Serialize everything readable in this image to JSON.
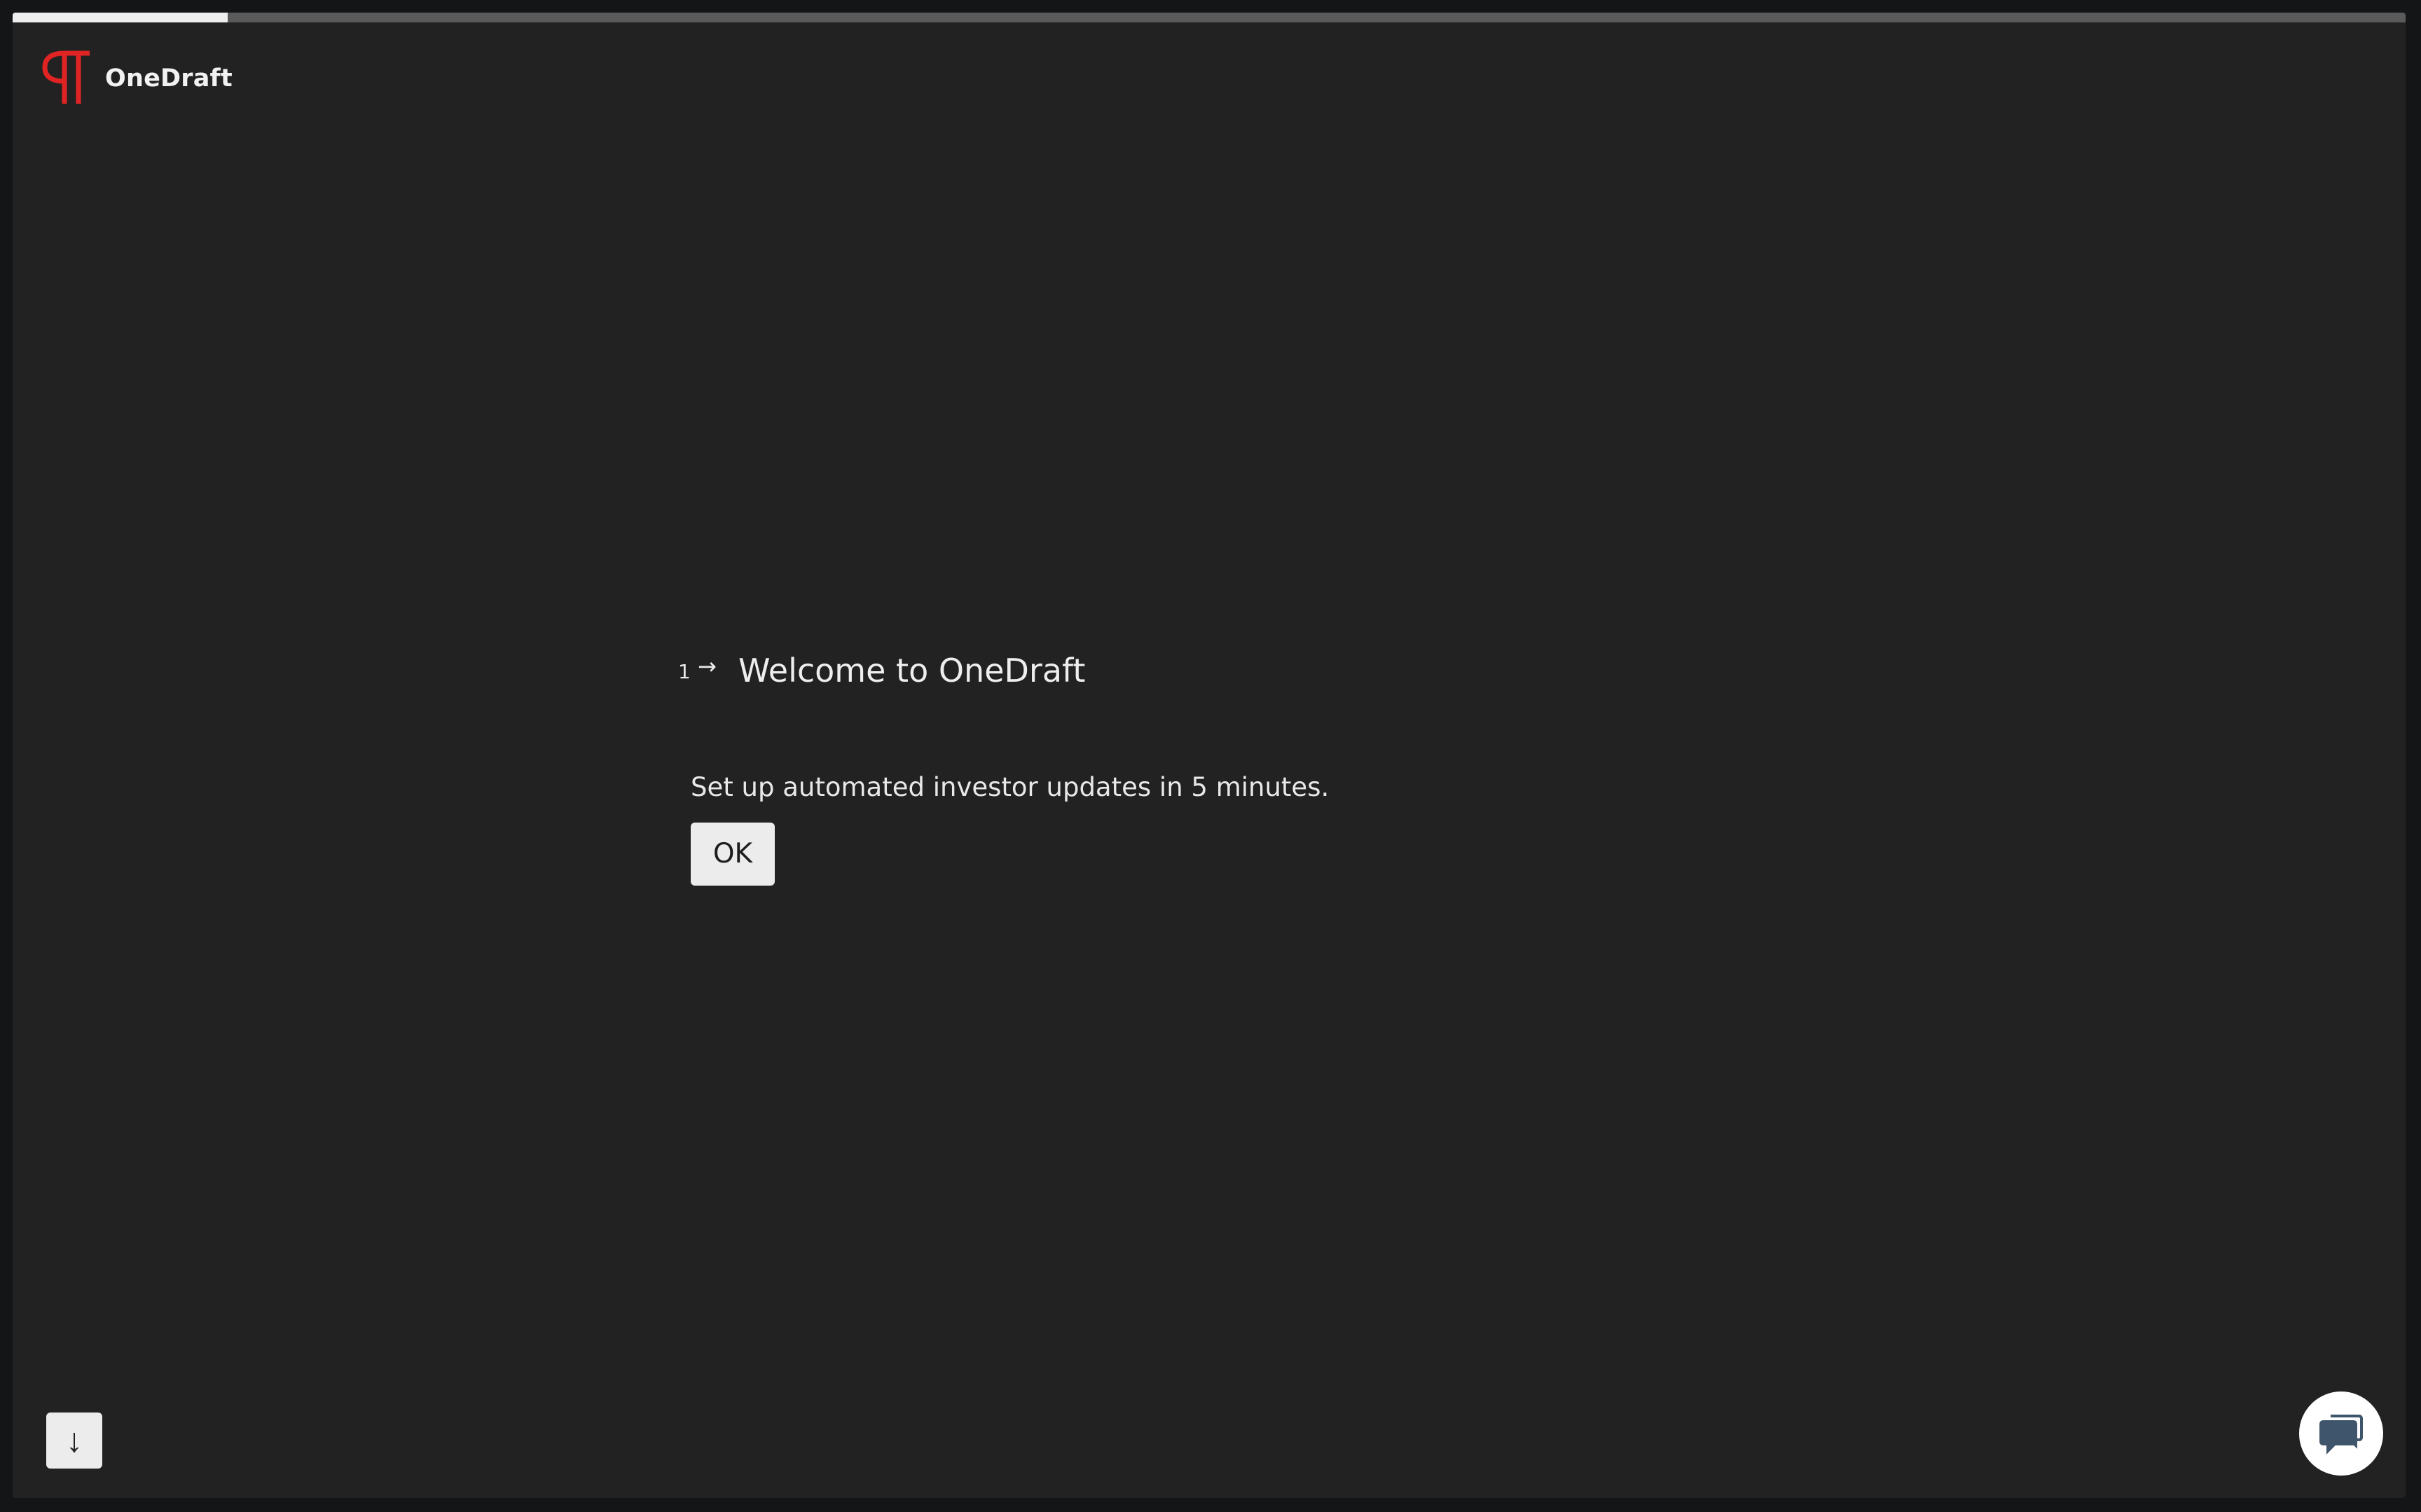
{
  "app": {
    "brand_name": "OneDraft",
    "progress_fraction": 0.09
  },
  "question": {
    "number": "1",
    "arrow_icon": "arrow-right-icon",
    "title": "Welcome to OneDraft",
    "description": "Set up automated investor updates in 5 minutes.",
    "ok_label": "OK"
  },
  "controls": {
    "next_icon": "arrow-down-icon",
    "chat_icon": "chat-bubbles-icon"
  },
  "colors": {
    "accent": "#e02424",
    "background": "#222222",
    "chat_icon": "#3f556b"
  }
}
